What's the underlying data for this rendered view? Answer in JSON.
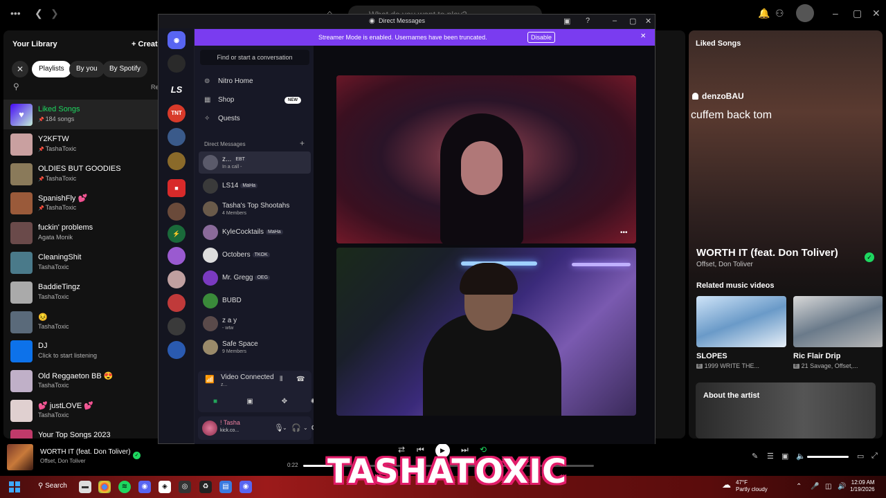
{
  "spotify": {
    "search_placeholder": "What do you want to play?",
    "library": {
      "title": "Your Library",
      "create_label": "Creat",
      "filters": [
        "Playlists",
        "By you",
        "By Spotify"
      ],
      "recents_label": "Re",
      "items": [
        {
          "title": "Liked Songs",
          "subtitle": "184 songs",
          "pinned": true,
          "color": "#7a4cf0"
        },
        {
          "title": "Y2KFTW",
          "subtitle": "TashaToxic",
          "pinned": true,
          "color": "#c9a0a0"
        },
        {
          "title": "OLDIES BUT GOODIES",
          "subtitle": "TashaToxic",
          "pinned": true,
          "color": "#8a7a5a"
        },
        {
          "title": "SpanishFly 💕",
          "subtitle": "TashaToxic",
          "pinned": true,
          "color": "#9a5a3a"
        },
        {
          "title": "fuckin' problems",
          "subtitle": "Agata Monik",
          "pinned": false,
          "color": "#6a4a4a"
        },
        {
          "title": "CleaningShit",
          "subtitle": "TashaToxic",
          "pinned": false,
          "color": "#4a7a8a"
        },
        {
          "title": "BaddieTingz",
          "subtitle": "TashaToxic",
          "pinned": false,
          "color": "#aaaaaa"
        },
        {
          "title": "😣",
          "subtitle": "TashaToxic",
          "pinned": false,
          "color": "#5a6a7a"
        },
        {
          "title": "DJ",
          "subtitle": "Click to start listening",
          "pinned": false,
          "color": "#0d72ea"
        },
        {
          "title": "Old Reggaeton BB 😍",
          "subtitle": "TashaToxic",
          "pinned": false,
          "color": "#c0b0c8"
        },
        {
          "title": "💕 justLOVE 💕",
          "subtitle": "TashaToxic",
          "pinned": false,
          "color": "#e0d0d0"
        },
        {
          "title": "Your Top Songs 2023",
          "subtitle": "",
          "pinned": false,
          "color": "#c03a6a"
        }
      ]
    },
    "now_playing_view": {
      "header": "Liked Songs",
      "lyric_user": "denzoBAU",
      "lyric_text": "cuffem back tom",
      "song_title": "WORTH IT (feat. Don Toliver)",
      "song_artist": "Offset, Don Toliver",
      "related_header": "Related music videos",
      "videos": [
        {
          "title": "SLOPES",
          "subtitle": "1999 WRITE THE...",
          "explicit": "E"
        },
        {
          "title": "Ric Flair Drip",
          "subtitle": "21 Savage, Offset,...",
          "explicit": "E"
        }
      ],
      "about_label": "About the artist"
    },
    "player": {
      "title": "WORTH IT (feat. Don Toliver)",
      "artist": "Offset, Don Toliver",
      "elapsed": "0:22",
      "progress": 0.1,
      "volume": 1.0
    }
  },
  "discord": {
    "window_title": "Direct Messages",
    "banner": {
      "text": "Streamer Mode is enabled. Usernames have been truncated.",
      "button": "Disable"
    },
    "find_placeholder": "Find or start a conversation",
    "nav": [
      {
        "label": "Nitro Home",
        "icon": "nitro-icon"
      },
      {
        "label": "Shop",
        "icon": "shop-icon",
        "badge": "NEW"
      },
      {
        "label": "Quests",
        "icon": "quests-icon"
      }
    ],
    "dm_header": "Direct Messages",
    "dms": [
      {
        "name": "z...",
        "tag": "EBT",
        "status": "In a call -",
        "color": "#5a5a6a"
      },
      {
        "name": "LS14",
        "tag": "MaHa",
        "status": "",
        "color": "#3a3a3a"
      },
      {
        "name": "Tasha's Top Shootahs",
        "tag": "",
        "status": "4 Members",
        "color": "#6a5a4a"
      },
      {
        "name": "KyleCocktails",
        "tag": "MaHa",
        "status": "",
        "color": "#8a6a9a"
      },
      {
        "name": "Octobers",
        "tag": "TKOK",
        "status": "",
        "color": "#dddddd"
      },
      {
        "name": "Mr. Gregg",
        "tag": "OEG",
        "status": "",
        "color": "#7a3ac0"
      },
      {
        "name": "BUBD",
        "tag": "",
        "status": "",
        "color": "#3a8a3a"
      },
      {
        "name": "z a y",
        "tag": "",
        "status": "- wtw",
        "color": "#5a4a4a"
      },
      {
        "name": "Safe Space",
        "tag": "",
        "status": "9 Members",
        "color": "#9a8a6a"
      }
    ],
    "voice": {
      "status": "Video Connected",
      "channel": "z..."
    },
    "user": {
      "name": "! Tasha",
      "status": "kick.co..."
    },
    "guilds": [
      "LS",
      "TNT"
    ]
  },
  "overlay_text": "TASHATOXIC",
  "taskbar": {
    "search_label": "Search",
    "weather_temp": "47°F",
    "weather_desc": "Partly cloudy",
    "time": "12:09 AM",
    "date": "1/19/2026"
  }
}
